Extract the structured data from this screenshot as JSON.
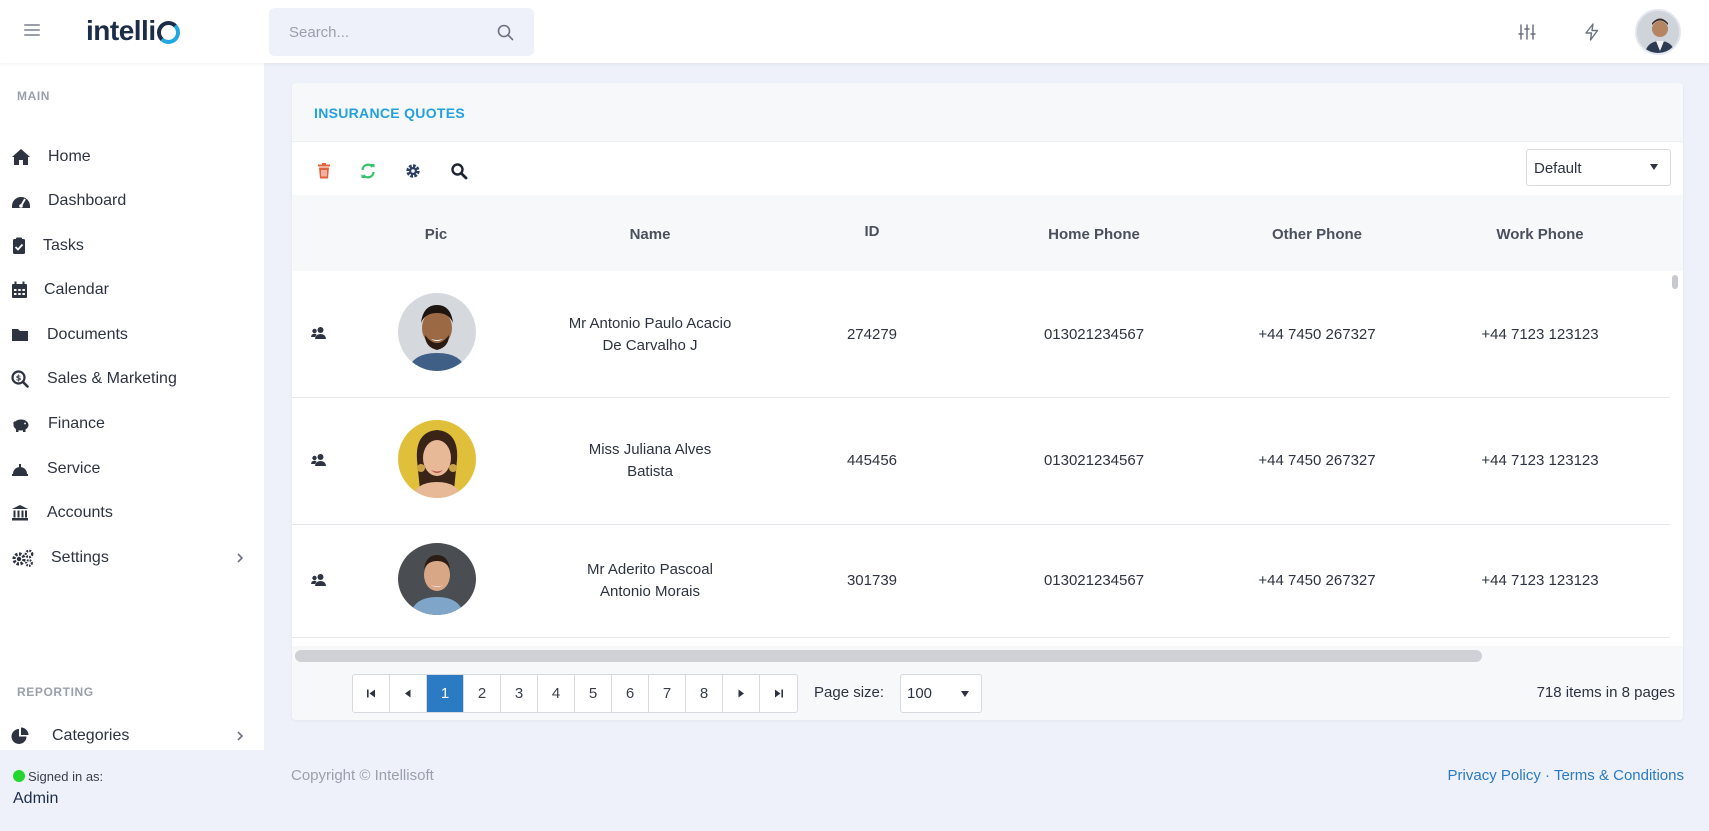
{
  "app": {
    "logo_text": "intelli"
  },
  "search": {
    "placeholder": "Search..."
  },
  "sidebar": {
    "main_label": "MAIN",
    "items": [
      {
        "label": "Home",
        "icon": "home-icon"
      },
      {
        "label": "Dashboard",
        "icon": "dashboard-icon"
      },
      {
        "label": "Tasks",
        "icon": "tasks-icon"
      },
      {
        "label": "Calendar",
        "icon": "calendar-icon"
      },
      {
        "label": "Documents",
        "icon": "folder-icon"
      },
      {
        "label": "Sales & Marketing",
        "icon": "search-dollar-icon"
      },
      {
        "label": "Finance",
        "icon": "piggy-bank-icon"
      },
      {
        "label": "Service",
        "icon": "bell-service-icon"
      },
      {
        "label": "Accounts",
        "icon": "bank-icon"
      },
      {
        "label": "Settings",
        "icon": "cogs-icon"
      }
    ],
    "reporting_label": "REPORTING",
    "categories": {
      "label": "Categories",
      "icon": "pie-chart-icon"
    },
    "signed_in_label": "Signed in as:",
    "user": "Admin"
  },
  "card": {
    "title": "INSURANCE QUOTES",
    "view_select": "Default",
    "columns": [
      "Pic",
      "Name",
      "ID",
      "Home Phone",
      "Other Phone",
      "Work Phone"
    ],
    "rows": [
      {
        "name_line1": "Mr Antonio Paulo Acacio",
        "name_line2": "De Carvalho J",
        "id": "274279",
        "home_phone": "013021234567",
        "other_phone": "+44 7450 267327",
        "work_phone": "+44 7123 123123"
      },
      {
        "name_line1": "Miss Juliana Alves",
        "name_line2": "Batista",
        "id": "445456",
        "home_phone": "013021234567",
        "other_phone": "+44 7450 267327",
        "work_phone": "+44 7123 123123"
      },
      {
        "name_line1": "Mr Aderito Pascoal",
        "name_line2": "Antonio Morais",
        "id": "301739",
        "home_phone": "013021234567",
        "other_phone": "+44 7450 267327",
        "work_phone": "+44 7123 123123"
      }
    ],
    "pager": {
      "first": "⏮",
      "prev": "◀",
      "next": "▶",
      "last": "⏭",
      "pages": [
        "1",
        "2",
        "3",
        "4",
        "5",
        "6",
        "7",
        "8"
      ],
      "current": "1",
      "page_size_label": "Page size:",
      "page_size": "100",
      "items_info": "718 items in 8 pages"
    }
  },
  "footer": {
    "copyright": "Copyright © Intellisoft",
    "privacy": "Privacy Policy",
    "separator": " · ",
    "terms": "Terms & Conditions"
  },
  "colors": {
    "accent": "#22a0df",
    "primary": "#2a7bc4",
    "status_online": "#22d62d"
  }
}
